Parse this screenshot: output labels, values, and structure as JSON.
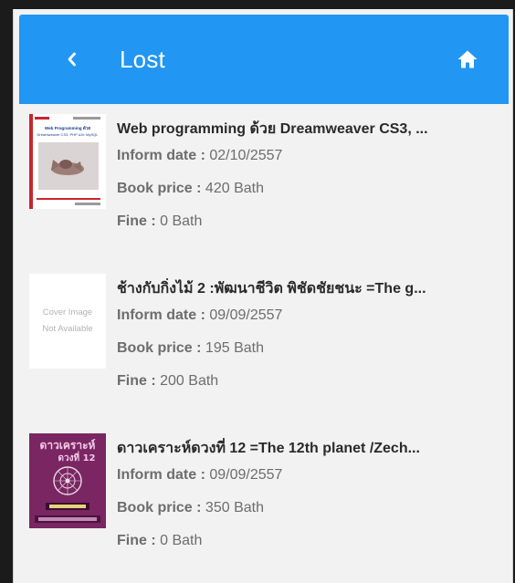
{
  "header": {
    "title": "Lost",
    "bg_color": "#2196f3",
    "back_icon": "chevron-left-icon",
    "home_icon": "home-icon"
  },
  "items": [
    {
      "title": "Web programming ด้วย Dreamweaver CS3, ...",
      "inform_label": "Inform date :",
      "inform_value": "02/10/2557",
      "price_label": "Book price :",
      "price_value": "420 Bath",
      "fine_label": "Fine :",
      "fine_value": "0 Bath",
      "cover": {
        "type": "image",
        "line1": "Web Programming ด้วย",
        "line2": "Dreamweaver CS3, PHP และ MySQL"
      }
    },
    {
      "title": "ช้างกับกิ่งไม้ 2 :พัฒนาชีวิต พิชัดชัยชนะ =The g...",
      "inform_label": "Inform date :",
      "inform_value": "09/09/2557",
      "price_label": "Book price :",
      "price_value": "195 Bath",
      "fine_label": "Fine :",
      "fine_value": "200 Bath",
      "cover": {
        "type": "placeholder",
        "line1": "Cover Image",
        "line2": "Not Available"
      }
    },
    {
      "title": "ดาวเคราะห์ดวงที่ 12 =The 12th planet /Zech...",
      "inform_label": "Inform date :",
      "inform_value": "09/09/2557",
      "price_label": "Book price :",
      "price_value": "350 Bath",
      "fine_label": "Fine :",
      "fine_value": "0 Bath",
      "cover": {
        "type": "image",
        "line1": "ดาวเคราะห์",
        "line2": "ดวงที่ 12"
      }
    }
  ]
}
